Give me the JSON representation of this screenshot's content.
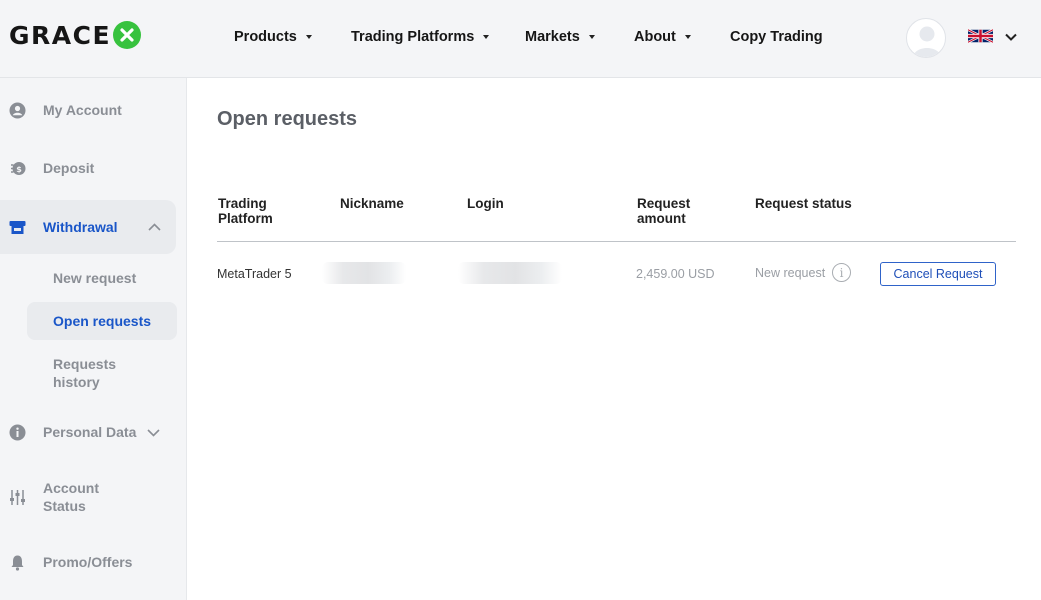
{
  "brand": {
    "name_prefix": "GRACE",
    "accent_color": "#37c23e",
    "active_color": "#1a56c8"
  },
  "header": {
    "nav": [
      {
        "label": "Products",
        "has_dropdown": true
      },
      {
        "label": "Trading Platforms",
        "has_dropdown": true
      },
      {
        "label": "Markets",
        "has_dropdown": true
      },
      {
        "label": "About",
        "has_dropdown": true
      },
      {
        "label": "Copy Trading",
        "has_dropdown": false
      }
    ],
    "avatar_icon": "user-avatar-icon",
    "language_icon": "uk-flag-icon"
  },
  "sidebar": {
    "items": [
      {
        "label": "My Account",
        "icon": "user-circle-icon"
      },
      {
        "label": "Deposit",
        "icon": "deposit-coin-icon"
      },
      {
        "label": "Withdrawal",
        "icon": "withdrawal-icon",
        "expanded": true
      },
      {
        "label": "Personal Data",
        "icon": "info-circle-icon",
        "expanded": false
      },
      {
        "label": "Account Status",
        "icon": "sliders-icon"
      },
      {
        "label": "Promo/Offers",
        "icon": "bell-icon"
      }
    ],
    "withdrawal_sub": [
      {
        "label": "New request"
      },
      {
        "label": "Open requests",
        "active": true
      },
      {
        "label": "Requests history"
      }
    ]
  },
  "main": {
    "title": "Open requests",
    "table": {
      "columns": [
        "Trading Platform",
        "Nickname",
        "Login",
        "Request amount",
        "Request status"
      ],
      "rows": [
        {
          "platform": "MetaTrader 5",
          "nickname": "",
          "login": "",
          "amount": "2,459.00 USD",
          "status": "New request",
          "action": "Cancel Request"
        }
      ]
    }
  }
}
